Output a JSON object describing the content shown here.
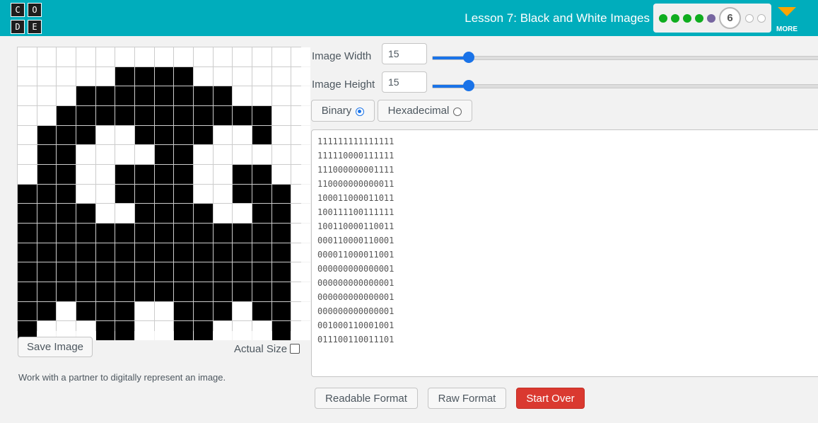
{
  "header": {
    "logo_letters": [
      "C",
      "O",
      "D",
      "E"
    ],
    "lesson_title": "Lesson 7: Black and White Images",
    "progress": {
      "current_level": "6",
      "done_count": 4,
      "current_color": "#7665a0",
      "done_color": "#0fad1f"
    },
    "more_label": "MORE",
    "accent_color": "#00adbc"
  },
  "grid": {
    "width": 15,
    "height": 15,
    "rows": [
      "111111111111111",
      "111110000111111",
      "111000000001111",
      "110000000000011",
      "100011000011011",
      "100111100111111",
      "100110000110011",
      "000110000110001",
      "000011000011001",
      "000000000000001",
      "000000000000001",
      "000000000000001",
      "000000000000001",
      "001000110001001",
      "011100110011101"
    ]
  },
  "controls": {
    "save_image": "Save Image",
    "actual_size": "Actual Size",
    "instructions": "Work with a partner to digitally represent an image.",
    "image_width_label": "Image Width",
    "image_width_value": "15",
    "image_height_label": "Image Height",
    "image_height_value": "15",
    "binary_label": "Binary",
    "hex_label": "Hexadecimal",
    "readable_format": "Readable Format",
    "raw_format": "Raw Format",
    "start_over": "Start Over"
  },
  "binary_text": [
    "111111111111111",
    "111110000111111",
    "111000000001111",
    "110000000000011",
    "100011000011011",
    "100111100111111",
    "100110000110011",
    "000110000110001",
    "000011000011001",
    "000000000000001",
    "000000000000001",
    "000000000000001",
    "000000000000001",
    "001000110001001",
    "011100110011101"
  ]
}
